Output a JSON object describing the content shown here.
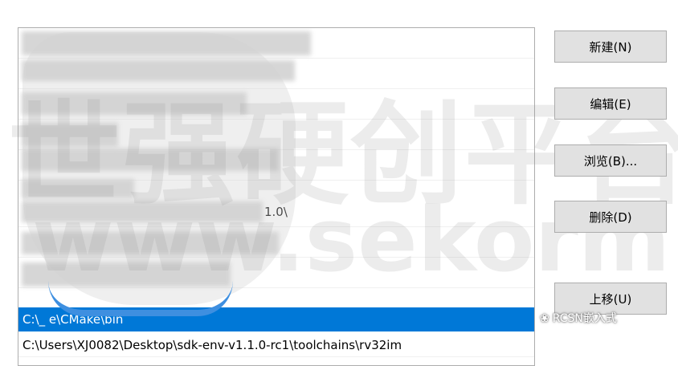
{
  "path_list": {
    "rows": [
      {
        "text": ""
      },
      {
        "text": ""
      },
      {
        "text": ""
      },
      {
        "text": ""
      },
      {
        "text": ""
      },
      {
        "text": "1.0\\"
      },
      {
        "text": ""
      },
      {
        "text": ""
      },
      {
        "text": "C:\\_ e\\CMake\\bin",
        "selected": true
      },
      {
        "text": "C:\\Users\\XJ0082\\Desktop\\sdk-env-v1.1.0-rc1\\toolchains\\rv32im"
      }
    ]
  },
  "buttons": {
    "new": "新建(N)",
    "edit": "编辑(E)",
    "browse": "浏览(B)...",
    "delete": "删除(D)",
    "move_up": "上移(U)"
  },
  "watermark": {
    "chinese": "世强硬创平台",
    "url": "www.sekorm.com",
    "badge": "RCSN嵌入式"
  },
  "colors": {
    "selection": "#0078d7",
    "button_face": "#e1e1e1",
    "border": "#adadad"
  }
}
